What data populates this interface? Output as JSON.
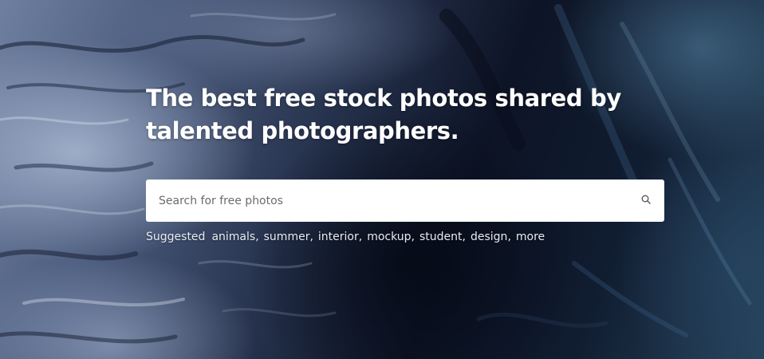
{
  "hero": {
    "headline": "The best free stock photos shared by\ntalented photographers."
  },
  "search": {
    "placeholder": "Search for free photos",
    "icon": "search-icon"
  },
  "suggested": {
    "label": "Suggested",
    "items": [
      "animals",
      "summer",
      "interior",
      "mockup",
      "student",
      "design"
    ],
    "more_label": "more"
  },
  "colors": {
    "text": "#ffffff",
    "search_bg": "#ffffff",
    "placeholder": "#6b6b6b"
  }
}
